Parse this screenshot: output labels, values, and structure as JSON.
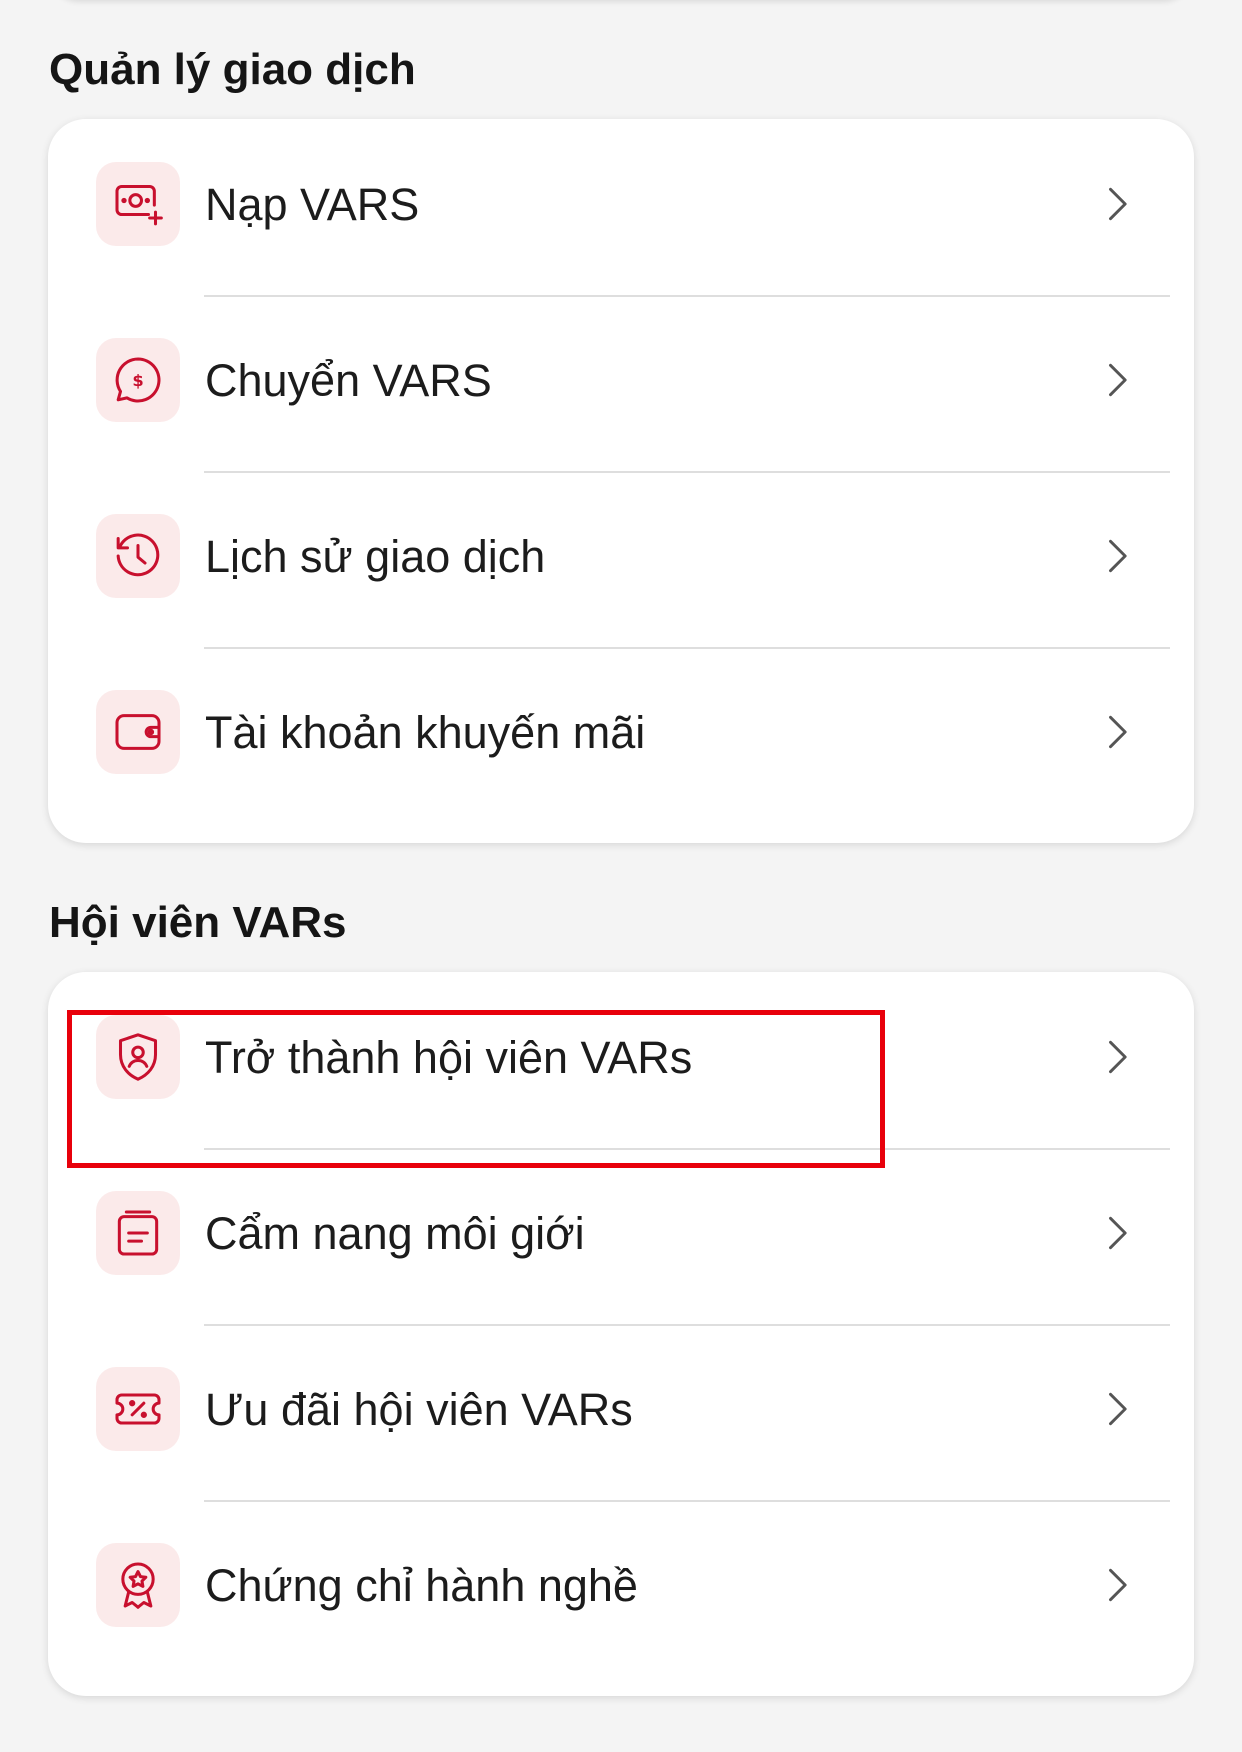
{
  "sections": [
    {
      "title": "Quản lý giao dịch",
      "items": [
        {
          "label": "Nạp VARS",
          "icon": "money-add-icon"
        },
        {
          "label": "Chuyển VARS",
          "icon": "dollar-chat-icon"
        },
        {
          "label": "Lịch sử giao dịch",
          "icon": "history-clock-icon"
        },
        {
          "label": "Tài khoản khuyến mãi",
          "icon": "wallet-icon"
        }
      ]
    },
    {
      "title": "Hội viên VARs",
      "items": [
        {
          "label": "Trở thành hội viên VARs",
          "icon": "shield-user-icon"
        },
        {
          "label": "Cẩm nang môi giới",
          "icon": "handbook-icon"
        },
        {
          "label": "Ưu đãi hội viên VARs",
          "icon": "discount-ticket-icon"
        },
        {
          "label": "Chứng chỉ hành nghề",
          "icon": "certificate-badge-icon"
        }
      ]
    }
  ],
  "colors": {
    "accent": "#c8102e",
    "icon_bg": "#fbeaea",
    "highlight": "#e8000b",
    "background": "#f4f4f4"
  }
}
